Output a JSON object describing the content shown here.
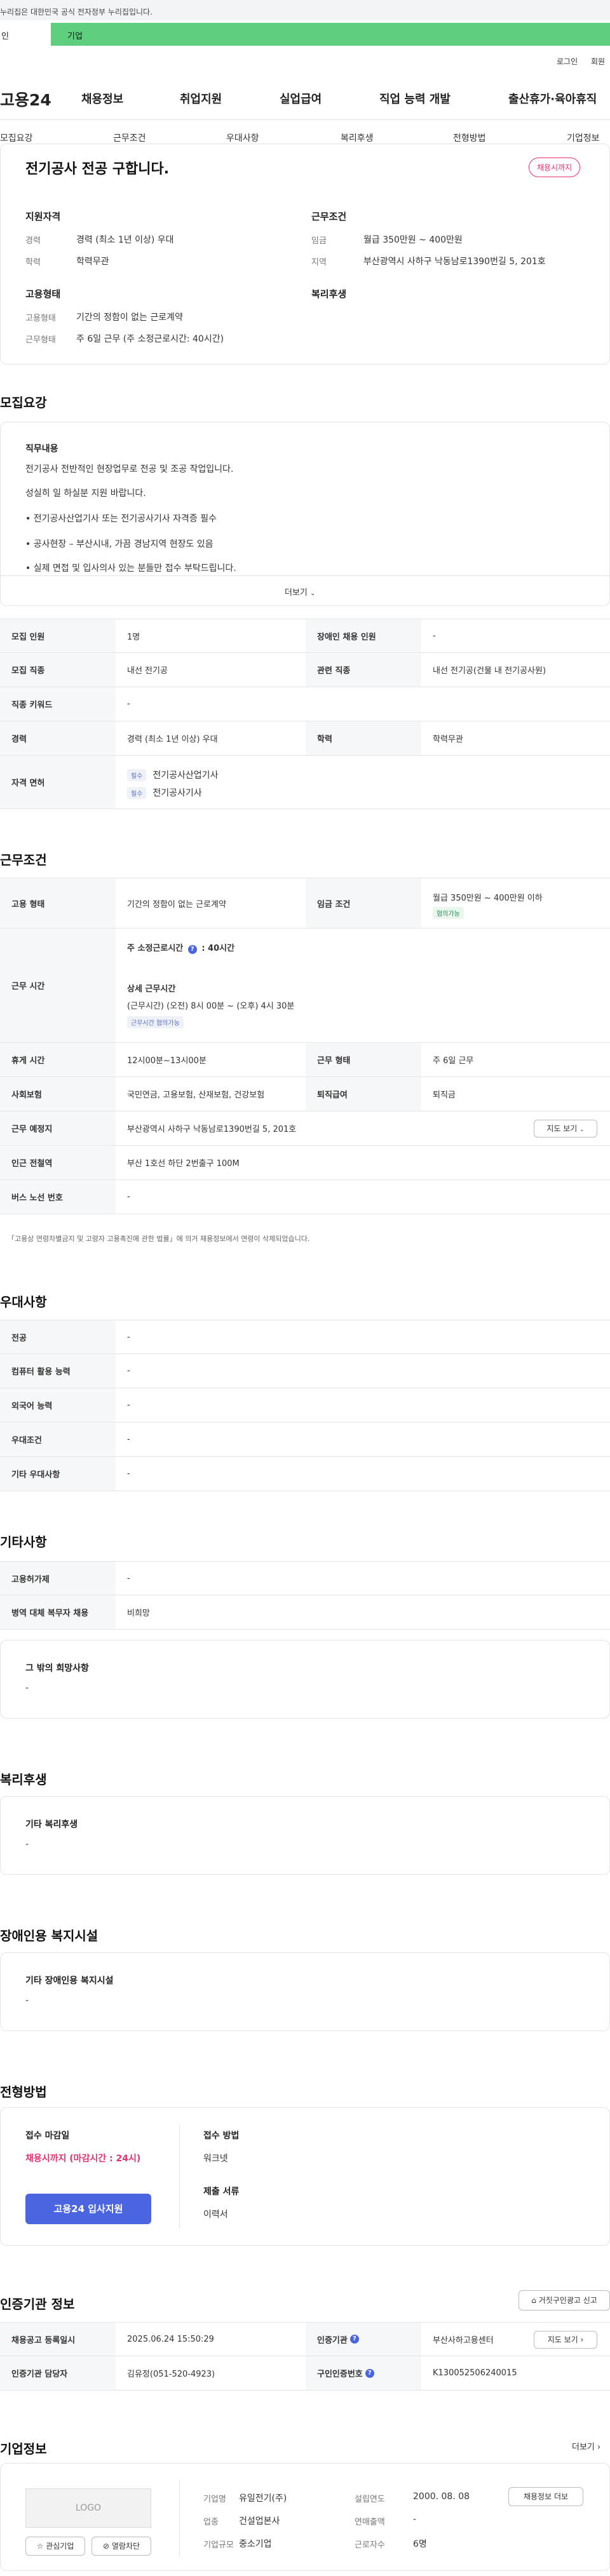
{
  "gov_notice": "누리집은 대한민국 공식 전자정부 누리집입니다.",
  "top_tabs": {
    "tab1": "인",
    "tab2": "기업"
  },
  "util": {
    "login": "로그인",
    "signup": "회원"
  },
  "logo": "고용24",
  "gnb": [
    "채용정보",
    "취업지원",
    "실업급여",
    "직업 능력 개발",
    "출산휴가·육아휴직"
  ],
  "lnb": [
    "모집요강",
    "근무조건",
    "우대사항",
    "복리후생",
    "전형방법",
    "기업정보"
  ],
  "summary": {
    "title": "전기공사 전공 구합니다.",
    "status_pill": "채용시까지",
    "qual_heading": "지원자격",
    "career_label": "경력",
    "career_value": "경력 (최소 1년 이상) 우대",
    "edu_label": "학력",
    "edu_value": "학력무관",
    "cond_heading": "근무조건",
    "wage_label": "임금",
    "wage_value": "월급 350만원 ~ 400만원",
    "area_label": "지역",
    "area_value": "부산광역시 사하구 낙동남로1390번길 5, 201호",
    "emp_heading": "고용형태",
    "emptype_label": "고용형태",
    "emptype_value": "기간의 정함이 없는 근로계약",
    "worktype_label": "근무형태",
    "worktype_value": "주 6일 근무 (주 소정근로시간: 40시간)",
    "welfare_heading": "복리후생"
  },
  "recruit": {
    "title": "모집요강",
    "duty_heading": "직무내용",
    "lines": [
      "전기공사 전반적인 현장업무로 전공 및 조공 작업입니다.",
      "성실히 일 하실분 지원 바랍니다.",
      "• 전기공사산업기사 또는 전기공사기사 자격증 필수",
      "• 공사현장 – 부산시내, 가끔 경남지역 현장도 있음",
      "• 실제 면접 및 입사의사 있는 분들만 접수 부탁드립니다."
    ],
    "more": "더보기",
    "rows": {
      "headcount_label": "모집 인원",
      "headcount_value": "1명",
      "disabled_label": "장애인 채용 인원",
      "disabled_value": "-",
      "job_label": "모집 직종",
      "job_value": "내선 전기공",
      "rel_label": "관련 직종",
      "rel_value": "내선 전기공(건물 내 전기공사원)",
      "kw_label": "직종 키워드",
      "kw_value": "-",
      "career_label": "경력",
      "career_value": "경력 (최소 1년 이상) 우대",
      "edu_label": "학력",
      "edu_value": "학력무관",
      "license_label": "자격 면허",
      "badge": "필수",
      "license1": "전기공사산업기사",
      "license2": "전기공사기사"
    }
  },
  "work": {
    "title": "근무조건",
    "emp_label": "고용 형태",
    "emp_value": "기간의 정함이 없는 근로계약",
    "wage_label": "임금 조건",
    "wage_value": "월급 350만원 ~ 400만원 이하",
    "wage_badge": "협의가능",
    "time_label": "근무 시간",
    "weekly": "주 소정근로시간",
    "weekly_val": ": 40시간",
    "detail_heading": "상세 근무시간",
    "detail_value": "(근무시간) (오전) 8시 00분 ~ (오후) 4시 30분",
    "time_badge": "근무시간 협의가능",
    "rest_label": "휴게 시간",
    "rest_value": "12시00분~13시00분",
    "form_label": "근무 형태",
    "form_value": "주 6일 근무",
    "ins_label": "사회보험",
    "ins_value": "국민연금, 고용보험, 산재보험, 건강보험",
    "retire_label": "퇴직급여",
    "retire_value": "퇴직금",
    "place_label": "근무 예정지",
    "place_value": "부산광역시 사하구 낙동남로1390번길 5, 201호",
    "map_btn": "지도 보기",
    "subway_label": "인근 전철역",
    "subway_value": "부산 1호선 하단 2번출구 100M",
    "bus_label": "버스 노선 번호",
    "bus_value": "-",
    "footnote": "「고용상 연령차별금지 및 고령자 고용촉진에 관한 법률」에 의거 채용정보에서 연령이 삭제되었습니다."
  },
  "pref": {
    "title": "우대사항",
    "rows": [
      {
        "label": "전공",
        "value": "-"
      },
      {
        "label": "컴퓨터 활용 능력",
        "value": "-"
      },
      {
        "label": "외국어 능력",
        "value": "-"
      },
      {
        "label": "우대조건",
        "value": "-"
      },
      {
        "label": "기타 우대사항",
        "value": "-"
      }
    ]
  },
  "etc": {
    "title": "기타사항",
    "employ_label": "고용허가제",
    "employ_value": "-",
    "military_label": "병역 대체 복무자 채용",
    "military_value": "비희망",
    "other_heading": "그 밖의 희망사항",
    "other_value": "-"
  },
  "welfare": {
    "title": "복리후생",
    "heading": "기타 복리후생",
    "value": "-"
  },
  "disabled": {
    "title": "장애인용 복지시설",
    "heading": "기타 장애인용 복지시설",
    "value": "-"
  },
  "select": {
    "title": "전형방법",
    "deadline_label": "접수 마감일",
    "deadline_value": "채용시까지 (마감시간 : 24시)",
    "apply_btn": "고용24 입사지원",
    "method_label": "접수 방법",
    "method_value": "워크넷",
    "docs_label": "제출 서류",
    "docs_value": "이력서"
  },
  "agency": {
    "title": "인증기관 정보",
    "report_btn": "거짓구인광고 신고",
    "reg_label": "채용공고 등록일시",
    "reg_value": "2025.06.24 15:50:29",
    "org_label": "인증기관",
    "org_value": "부산사하고용센터",
    "map_btn": "지도 보기",
    "staff_label": "인증기관 담당자",
    "staff_value": "김유정(051-520-4923)",
    "auth_label": "구인인증번호",
    "auth_value": "K130052506240015"
  },
  "company": {
    "title": "기업정보",
    "more": "더보기",
    "logo": "LOGO",
    "interest": "관심기업",
    "block": "열람차단",
    "name_label": "기업명",
    "name_value": "유일전기(주)",
    "year_label": "설립연도",
    "year_value": "2000. 08. 08",
    "recruit_btn": "채용정보 더보",
    "ind_label": "업종",
    "ind_value": "건설업본사",
    "sales_label": "연매출액",
    "sales_value": "-",
    "size_label": "기업규모",
    "size_value": "중소기업",
    "staff_label": "근로자수",
    "staff_value": "6명"
  }
}
